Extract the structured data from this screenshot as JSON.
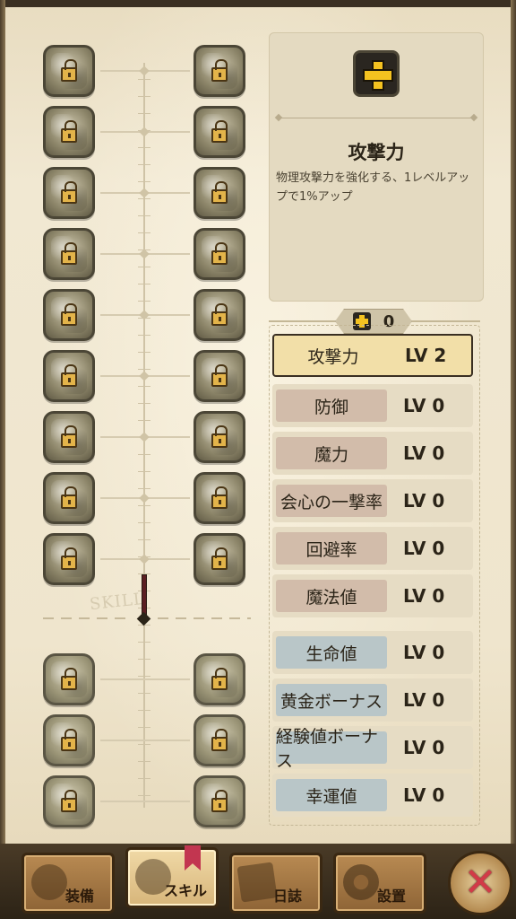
{
  "skill_tree": {
    "divider_label": "SKILL",
    "unlocked_progress": 0
  },
  "info": {
    "icon": "plus-icon",
    "title": "攻撃力",
    "description": "物理攻撃力を強化する、1レベルアップで1%アップ"
  },
  "points": {
    "icon": "plus-icon",
    "value": "0"
  },
  "stats": [
    {
      "label": "攻撃力",
      "level": "LV 2",
      "selected": true
    },
    {
      "label": "防御",
      "level": "LV 0"
    },
    {
      "label": "魔力",
      "level": "LV 0"
    },
    {
      "label": "会心の一撃率",
      "level": "LV 0"
    },
    {
      "label": "回避率",
      "level": "LV 0"
    },
    {
      "label": "魔法値",
      "level": "LV 0"
    },
    {
      "label": "生命値",
      "level": "LV 0"
    },
    {
      "label": "黄金ボーナス",
      "level": "LV 0"
    },
    {
      "label": "経験値ボーナス",
      "level": "LV 0"
    },
    {
      "label": "幸運値",
      "level": "LV 0"
    }
  ],
  "nav": {
    "equip": "装備",
    "skill": "スキル",
    "journal": "日誌",
    "settings": "設置",
    "close": "✕"
  },
  "colors": {
    "accent_gold": "#f4c220",
    "close_red": "#d23a48",
    "selected_row": "#f2dfa8"
  }
}
